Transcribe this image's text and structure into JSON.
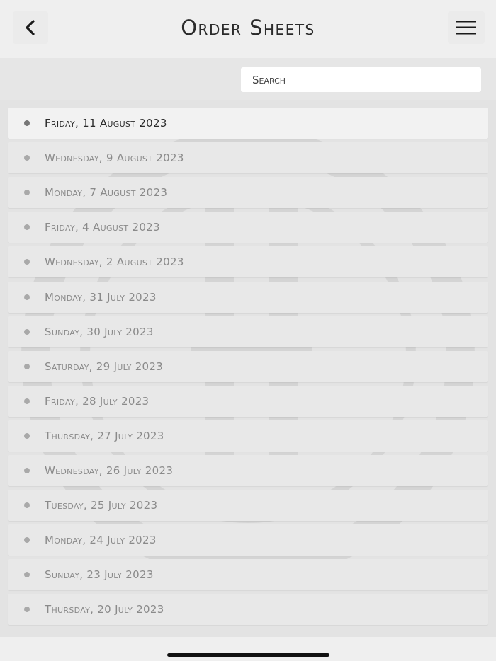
{
  "header": {
    "title": "Order Sheets",
    "back_icon": "chevron-left-icon",
    "menu_icon": "hamburger-menu-icon"
  },
  "search": {
    "placeholder": "Search",
    "value": ""
  },
  "list": {
    "selected_index": 0,
    "items": [
      {
        "label": "Friday, 11 August 2023"
      },
      {
        "label": "Wednesday, 9 August 2023"
      },
      {
        "label": "Monday, 7 August 2023"
      },
      {
        "label": "Friday, 4 August 2023"
      },
      {
        "label": "Wednesday, 2 August 2023"
      },
      {
        "label": "Monday, 31 July 2023"
      },
      {
        "label": "Sunday, 30 July 2023"
      },
      {
        "label": "Saturday, 29 July 2023"
      },
      {
        "label": "Friday, 28 July 2023"
      },
      {
        "label": "Thursday, 27 July 2023"
      },
      {
        "label": "Wednesday, 26 July 2023"
      },
      {
        "label": "Tuesday, 25 July 2023"
      },
      {
        "label": "Monday, 24 July 2023"
      },
      {
        "label": "Sunday, 23 July 2023"
      },
      {
        "label": "Thursday, 20 July 2023"
      }
    ]
  },
  "colors": {
    "background": "#e3e3e3",
    "header": "#efefef",
    "active_row": "#f2f2f2",
    "row": "#e8e8e8",
    "active_text": "#2b2b2b",
    "inactive_text": "#8a8a8a"
  }
}
